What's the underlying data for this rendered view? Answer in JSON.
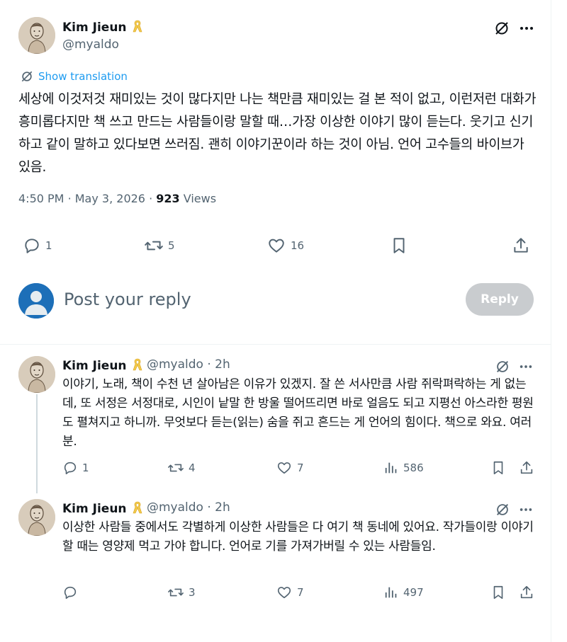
{
  "tweet": {
    "author": "Kim Jieun",
    "handle": "@myaldo",
    "translate_label": "Show translation",
    "text": "세상에 이것저것 재미있는 것이 많다지만 나는 책만큼 재미있는 걸 본 적이 없고, 이런저런 대화가 흥미롭다지만 책 쓰고 만드는 사람들이랑 말할 때…가장 이상한 이야기 많이 듣는다. 웃기고 신기하고 같이 말하고 있다보면 쓰러짐. 괜히 이야기꾼이라 하는 것이 아님. 언어 고수들의 바이브가 있음.",
    "time": "4:50 PM",
    "date": "May 3, 2026",
    "separator": "·",
    "views_count": "923",
    "views_label": "Views",
    "reply_count": "1",
    "repost_count": "5",
    "like_count": "16"
  },
  "compose": {
    "placeholder": "Post your reply",
    "button_label": "Reply"
  },
  "replies": [
    {
      "author": "Kim Jieun",
      "handle": "@myaldo",
      "age": "· 2h",
      "text": "이야기, 노래, 책이 수천 년 살아남은 이유가 있겠지. 잘 쓴 서사만큼 사람 쥐락펴락하는 게 없는데, 또 서정은 서정대로, 시인이 낱말 한 방울 떨어뜨리면 바로 얼음도 되고 지평선 아스라한 평원도 펼쳐지고 하니까. 무엇보다 듣는(읽는) 숨을 쥐고 흔드는 게 언어의 힘이다. 책으로 와요. 여러분.",
      "reply_count": "1",
      "repost_count": "4",
      "like_count": "7",
      "view_count": "586"
    },
    {
      "author": "Kim Jieun",
      "handle": "@myaldo",
      "age": "· 2h",
      "text": "이상한 사람들 중에서도 각별하게 이상한 사람들은 다 여기 책 동네에 있어요. 작가들이랑 이야기할 때는 영양제 먹고 가야 합니다. 언어로 기를 가져가버릴 수 있는 사람들임.",
      "reply_count": "",
      "repost_count": "3",
      "like_count": "7",
      "view_count": "497"
    }
  ],
  "colors": {
    "accent": "#1d9bf0",
    "muted": "#536471",
    "text": "#0f1419",
    "divider": "#eff3f4",
    "ribbon": "#f2c94c",
    "reply_button_disabled": "#c9cccf"
  }
}
